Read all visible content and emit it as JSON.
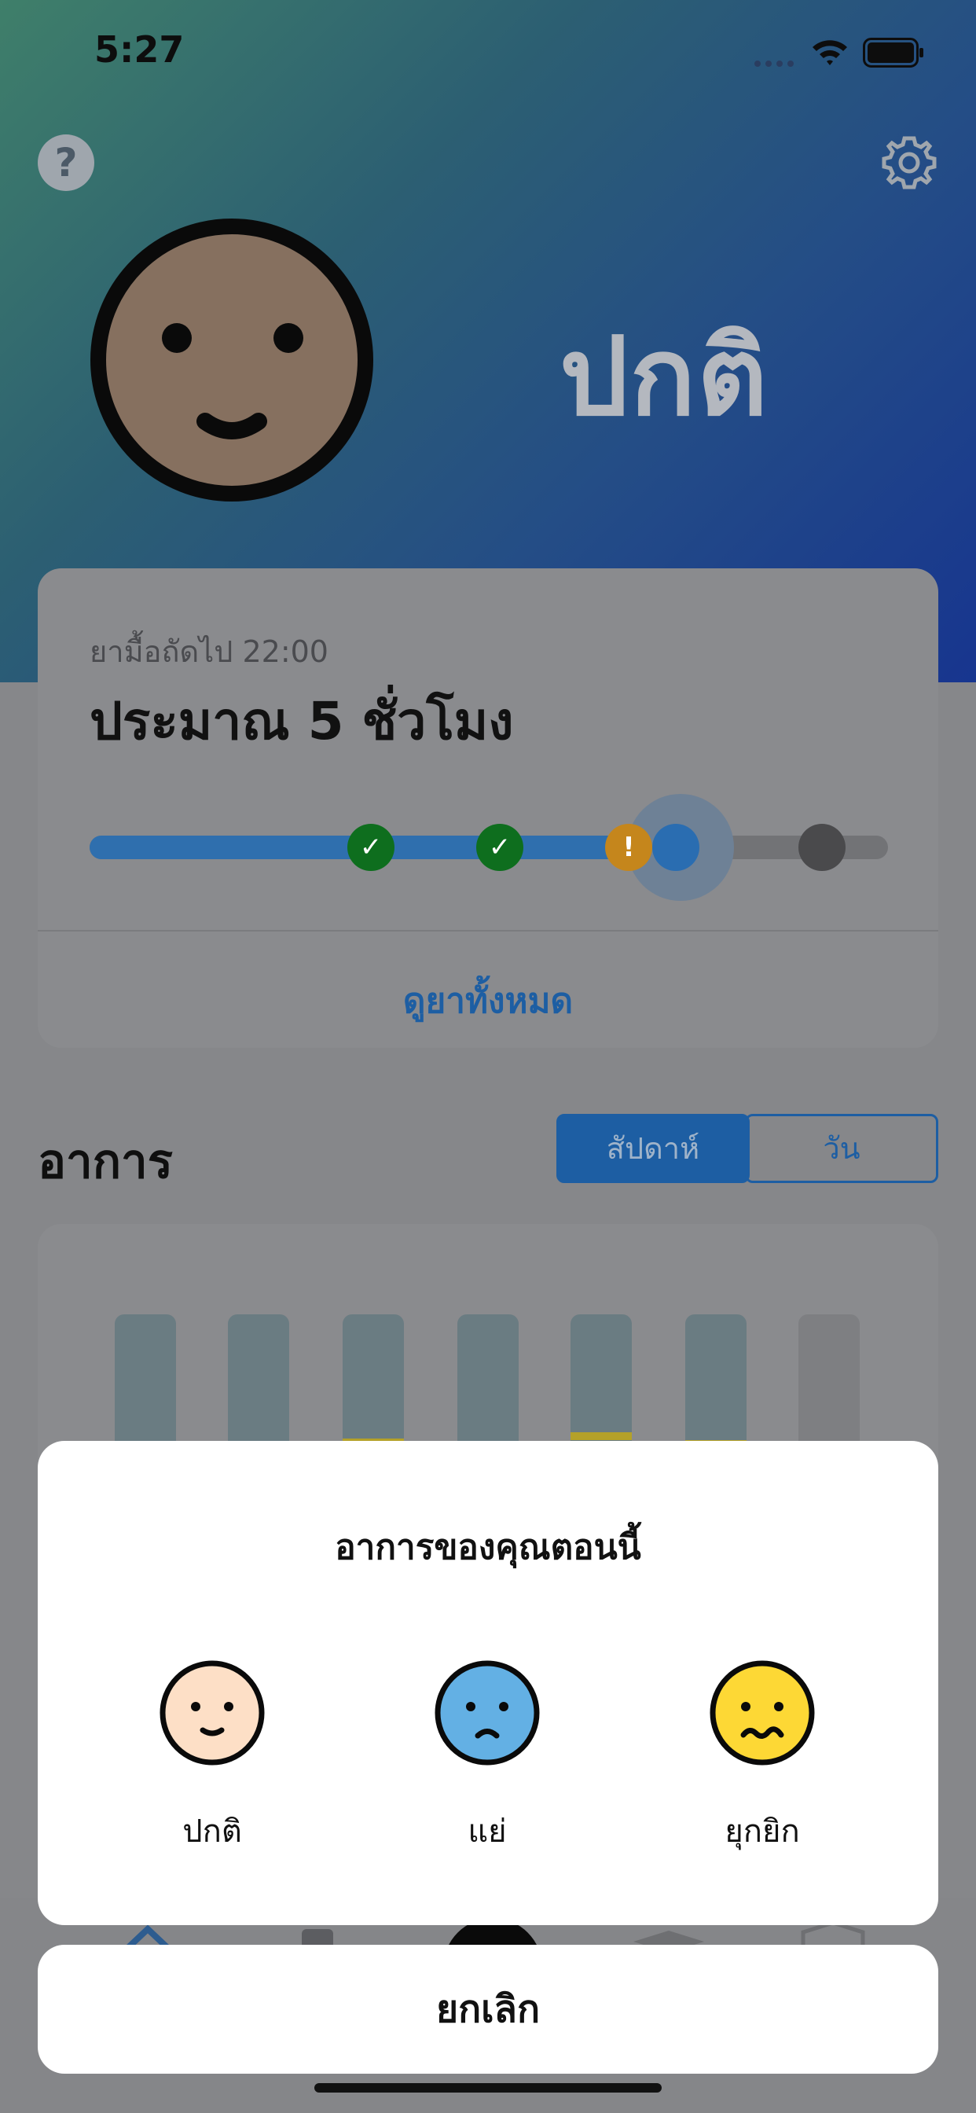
{
  "status_bar": {
    "time": "5:27"
  },
  "header": {
    "help_icon": "question-circle-icon",
    "settings_icon": "gear-icon",
    "mood_label": "ปกติ"
  },
  "medication_card": {
    "next_dose_label": "ยามื้อถัดไป 22:00",
    "time_remaining": "ประมาณ 5 ชั่วโมง",
    "progress_fraction": 0.79,
    "dose_states": [
      "taken",
      "taken",
      "warning",
      "current",
      "upcoming"
    ],
    "view_all_label": "ดูยาทั้งหมด"
  },
  "symptoms": {
    "title": "อาการ",
    "segment_week": "สัปดาห์",
    "segment_day": "วัน"
  },
  "sheet": {
    "title": "อาการของคุณตอนนี้",
    "options": [
      {
        "label": "ปกติ",
        "icon": "smile-face-icon",
        "color": "#FDDFC6"
      },
      {
        "label": "แย่",
        "icon": "sad-face-icon",
        "color": "#63B0E4"
      },
      {
        "label": "ยุกยิก",
        "icon": "uneasy-face-icon",
        "color": "#FDD835"
      }
    ],
    "cancel_label": "ยกเลิก"
  },
  "colors": {
    "accent": "#1D5EA3",
    "taken": "#0E6E1E",
    "warning": "#E39A18",
    "current": "#2F80ED"
  }
}
